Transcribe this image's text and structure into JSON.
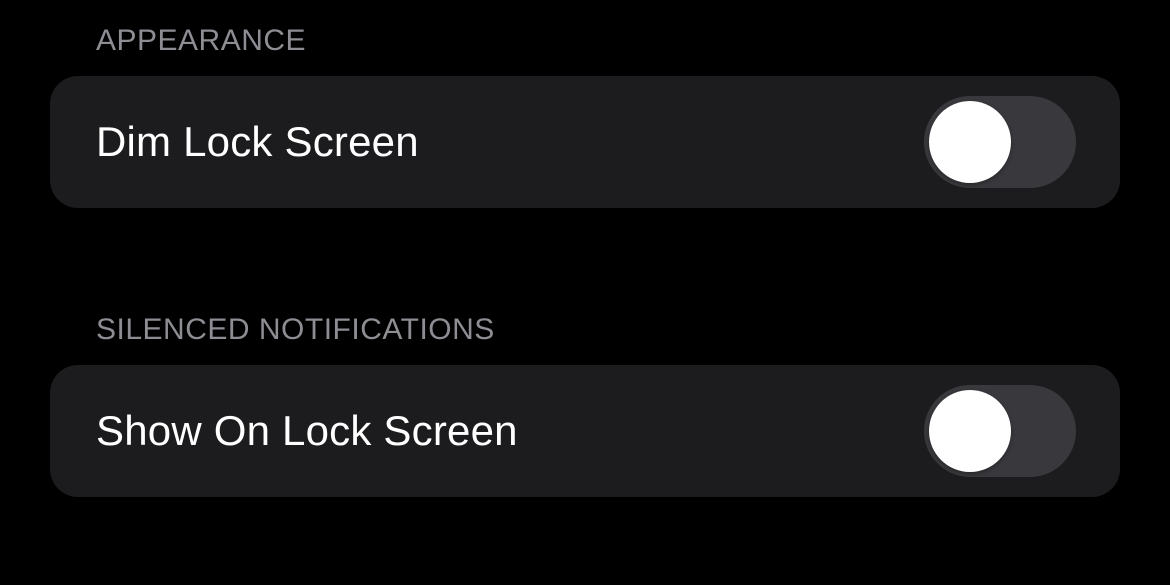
{
  "sections": {
    "appearance": {
      "header": "APPEARANCE",
      "rows": {
        "dim_lock_screen": {
          "label": "Dim Lock Screen",
          "on": false
        }
      }
    },
    "silenced_notifications": {
      "header": "SILENCED NOTIFICATIONS",
      "rows": {
        "show_on_lock_screen": {
          "label": "Show On Lock Screen",
          "on": false
        }
      }
    }
  }
}
